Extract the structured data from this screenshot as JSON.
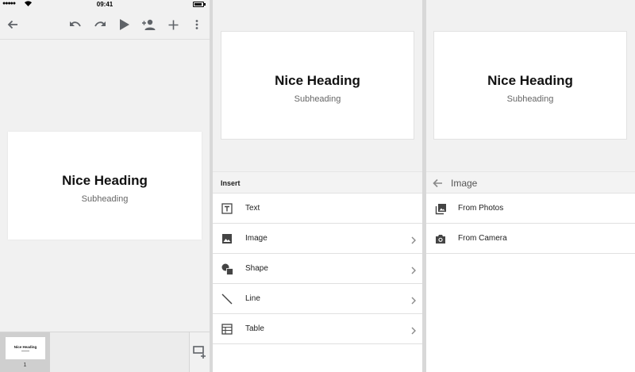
{
  "status_bar": {
    "signal": "●●●●●",
    "time": "09:41"
  },
  "toolbar": {
    "icons": [
      "back-icon",
      "undo-icon",
      "redo-icon",
      "play-icon",
      "add-person-icon",
      "add-icon",
      "more-vert-icon"
    ]
  },
  "slide": {
    "heading": "Nice Heading",
    "subheading": "Subheading"
  },
  "filmstrip": {
    "thumb_heading": "Nice Heading",
    "slide_number": "1"
  },
  "insert_menu": {
    "title": "Insert",
    "items": [
      {
        "label": "Text",
        "icon": "text-box-icon"
      },
      {
        "label": "Image",
        "icon": "image-icon"
      },
      {
        "label": "Shape",
        "icon": "shape-icon"
      },
      {
        "label": "Line",
        "icon": "line-icon"
      },
      {
        "label": "Table",
        "icon": "table-icon"
      }
    ]
  },
  "image_menu": {
    "title": "Image",
    "items": [
      {
        "label": "From Photos",
        "icon": "photo-library-icon"
      },
      {
        "label": "From Camera",
        "icon": "camera-icon"
      }
    ]
  },
  "colors": {
    "toolbar_bg": "#f1f1f1",
    "icon": "#5f6368",
    "menu_header_bg": "#f3f3f3"
  }
}
